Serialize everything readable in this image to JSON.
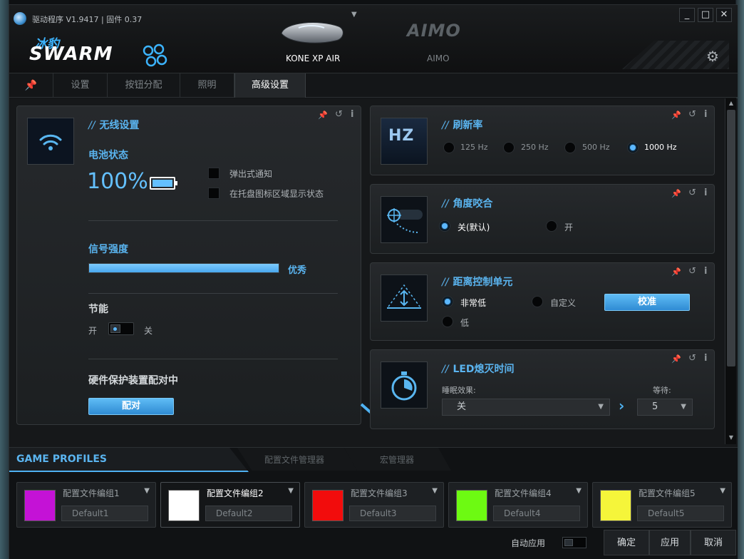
{
  "app": {
    "version_text": "驱动程序 V1.9417 | 固件 0.37",
    "logo_top": "冰豹",
    "logo_main": "SWARM",
    "devices": [
      {
        "label": "KONE XP AIR",
        "active": true
      },
      {
        "label": "AIMO",
        "active": false
      }
    ],
    "aimo_logo": "AIMO",
    "window_buttons": [
      "_",
      "□",
      "✕"
    ]
  },
  "tabs": [
    {
      "label": "",
      "icon": "pin-icon"
    },
    {
      "label": "设置"
    },
    {
      "label": "按钮分配"
    },
    {
      "label": "照明"
    },
    {
      "label": "高级设置",
      "active": true
    }
  ],
  "wireless": {
    "title": "无线设置",
    "battery_label": "电池状态",
    "battery_value": "100%",
    "battery_level": 1.0,
    "popup_notify": "弹出式通知",
    "tray_status": "在托盘图标区域显示状态",
    "signal_label": "信号强度",
    "signal_value": "优秀",
    "signal_level": 1.0,
    "power_save_label": "节能",
    "on_label": "开",
    "off_label": "关",
    "pairing_label": "硬件保护装置配对中",
    "pair_button": "配对"
  },
  "polling": {
    "title": "刷新率",
    "thumb_text": "HZ",
    "options": [
      "125 Hz",
      "250 Hz",
      "500 Hz",
      "1000 Hz"
    ],
    "selected": "1000 Hz"
  },
  "angle": {
    "title": "角度咬合",
    "off_label": "关(默认)",
    "on_label": "开",
    "selected": "关(默认)"
  },
  "lod": {
    "title": "距离控制单元",
    "very_low": "非常低",
    "custom": "自定义",
    "low": "低",
    "calibrate_button": "校准",
    "selected": "非常低"
  },
  "led": {
    "title": "LED熄灭时间",
    "sleep_label": "睡眠效果:",
    "sleep_value": "关",
    "wait_label": "等待:",
    "wait_value": "5"
  },
  "bottom": {
    "tab_profiles": "GAME PROFILES",
    "tab_manager": "配置文件管理器",
    "tab_macro": "宏管理器",
    "profiles": [
      {
        "name": "配置文件编组1",
        "field": "Default1",
        "color": "#c412d6",
        "selected": false
      },
      {
        "name": "配置文件编组2",
        "field": "Default2",
        "color": "#ffffff",
        "selected": true
      },
      {
        "name": "配置文件编组3",
        "field": "Default3",
        "color": "#f20c0c",
        "selected": false
      },
      {
        "name": "配置文件编组4",
        "field": "Default4",
        "color": "#6dfa12",
        "selected": false
      },
      {
        "name": "配置文件编组5",
        "field": "Default5",
        "color": "#f5f53a",
        "selected": false
      }
    ],
    "auto_apply": "自动应用",
    "ok_button": "确定",
    "apply_button": "应用",
    "cancel_button": "取消"
  }
}
